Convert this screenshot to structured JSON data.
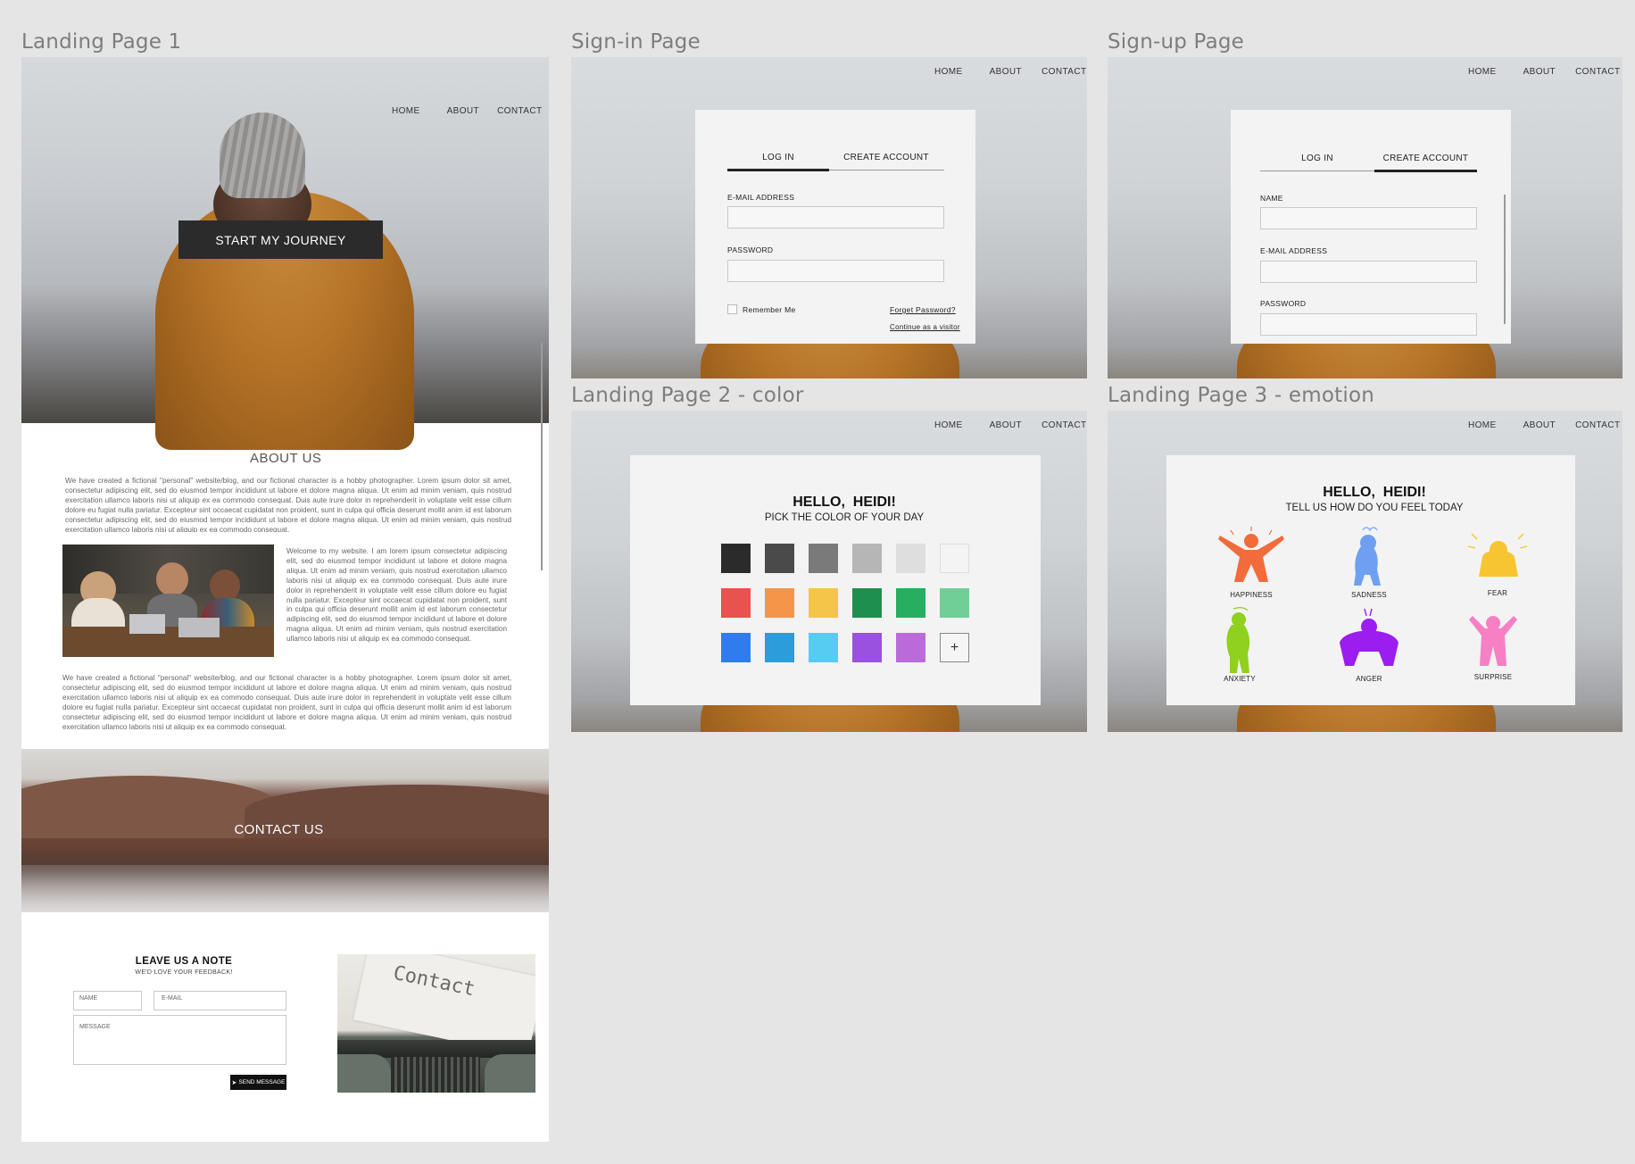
{
  "frames": {
    "landing1": "Landing Page 1",
    "signin": "Sign-in Page",
    "signup": "Sign-up Page",
    "landing2": "Landing Page 2 - color",
    "landing3": "Landing Page 3 - emotion"
  },
  "nav": {
    "home": "HOME",
    "about": "ABOUT",
    "contact": "CONTACT"
  },
  "landing1": {
    "cta": "START MY JOURNEY",
    "about_title": "ABOUT US",
    "para1": "We have created a fictional \"personal\" website/blog, and our fictional character is a hobby photographer. Lorem ipsum dolor sit amet, consectetur adipiscing elit, sed do eiusmod tempor incididunt ut labore et dolore magna aliqua. Ut enim ad minim veniam, quis nostrud exercitation ullamco laboris nisi ut aliquip ex ea commodo consequat. Duis aute irure dolor in reprehenderit in voluptate velit esse cillum dolore eu fugiat nulla pariatur. Excepteur sint occaecat cupidatat non proident, sunt in culpa qui officia deserunt mollit anim id est laborum consectetur adipiscing elit, sed do eiusmod tempor incididunt ut labore et dolore magna aliqua. Ut enim ad minim veniam, quis nostrud exercitation ullamco laboris nisi ut aliquip ex ea commodo consequat.",
    "para2": "Welcome to my website. I am lorem ipsum consectetur adipiscing elit, sed do eiusmod tempor incididunt ut labore et dolore magna aliqua. Ut enim ad minim veniam, quis nostrud exercitation ullamco laboris nisi ut aliquip ex ea commodo consequat. Duis aute irure dolor in reprehenderit in voluptate velit esse cillum dolore eu fugiat nulla pariatur. Excepteur sint occaecat cupidatat non proident, sunt in culpa qui officia deserunt mollit anim id est laborum consectetur adipiscing elit, sed do eiusmod tempor incididunt ut labore et dolore magna aliqua. Ut enim ad minim veniam, quis nostrud exercitation ullamco laboris nisi ut aliquip ex ea commodo consequat.",
    "para3": "We have created a fictional \"personal\" website/blog, and our fictional character is a hobby photographer. Lorem ipsum dolor sit amet, consectetur adipiscing elit, sed do eiusmod tempor incididunt ut labore et dolore magna aliqua. Ut enim ad minim veniam, quis nostrud exercitation ullamco laboris nisi ut aliquip ex ea commodo consequat. Duis aute irure dolor in reprehenderit in voluptate velit esse cillum dolore eu fugiat nulla pariatur. Excepteur sint occaecat cupidatat non proident, sunt in culpa qui officia deserunt mollit anim id est laborum consectetur adipiscing elit, sed do eiusmod tempor incididunt ut labore et dolore magna aliqua. Ut enim ad minim veniam, quis nostrud exercitation ullamco laboris nisi ut aliquip ex ea commodo consequat.",
    "contact_banner": "CONTACT US",
    "note_title": "LEAVE US A NOTE",
    "note_sub": "WE'D LOVE YOUR FEEDBACK!",
    "name_ph": "NAME",
    "email_ph": "E-MAIL",
    "message_ph": "MESSAGE",
    "send": "SEND MESSAGE",
    "typewriter_text": "Contact"
  },
  "signin": {
    "tab_login": "LOG IN",
    "tab_create": "CREATE ACCOUNT",
    "email_label": "E-MAIL ADDRESS",
    "password_label": "PASSWORD",
    "remember": "Remember Me",
    "forgot": "Forget Password?",
    "visitor": "Continue as a visitor"
  },
  "signup": {
    "tab_login": "LOG IN",
    "tab_create": "CREATE ACCOUNT",
    "name_label": "NAME",
    "email_label": "E-MAIL ADDRESS",
    "password_label": "PASSWORD"
  },
  "landing2": {
    "greeting": "HELLO,  HEIDI!",
    "prompt": "PICK THE COLOR OF YOUR DAY",
    "swatches": [
      "#2b2b2b",
      "#4a4a4a",
      "#7a7a7a",
      "#b6b6b6",
      "#dedede",
      "#f4f4f4",
      "#e8524f",
      "#f4954a",
      "#f5c54a",
      "#1f8f4d",
      "#27ae60",
      "#6fcf97",
      "#2f7ded",
      "#2d9cdb",
      "#56ccf2",
      "#9b51e0",
      "#bb6bd9"
    ],
    "add_symbol": "+"
  },
  "landing3": {
    "greeting": "HELLO,  HEIDI!",
    "prompt": "TELL US HOW DO YOU FEEL TODAY",
    "emotions": [
      {
        "label": "HAPPINESS",
        "color": "#f26b3a",
        "icon": "happiness-figure-icon"
      },
      {
        "label": "SADNESS",
        "color": "#6f9ff0",
        "icon": "sadness-figure-icon"
      },
      {
        "label": "FEAR",
        "color": "#f7c531",
        "icon": "fear-figure-icon"
      },
      {
        "label": "ANXIETY",
        "color": "#8fd11e",
        "icon": "anxiety-figure-icon"
      },
      {
        "label": "ANGER",
        "color": "#9b1df0",
        "icon": "anger-figure-icon"
      },
      {
        "label": "SURPRISE",
        "color": "#f77fc3",
        "icon": "surprise-figure-icon"
      }
    ]
  }
}
